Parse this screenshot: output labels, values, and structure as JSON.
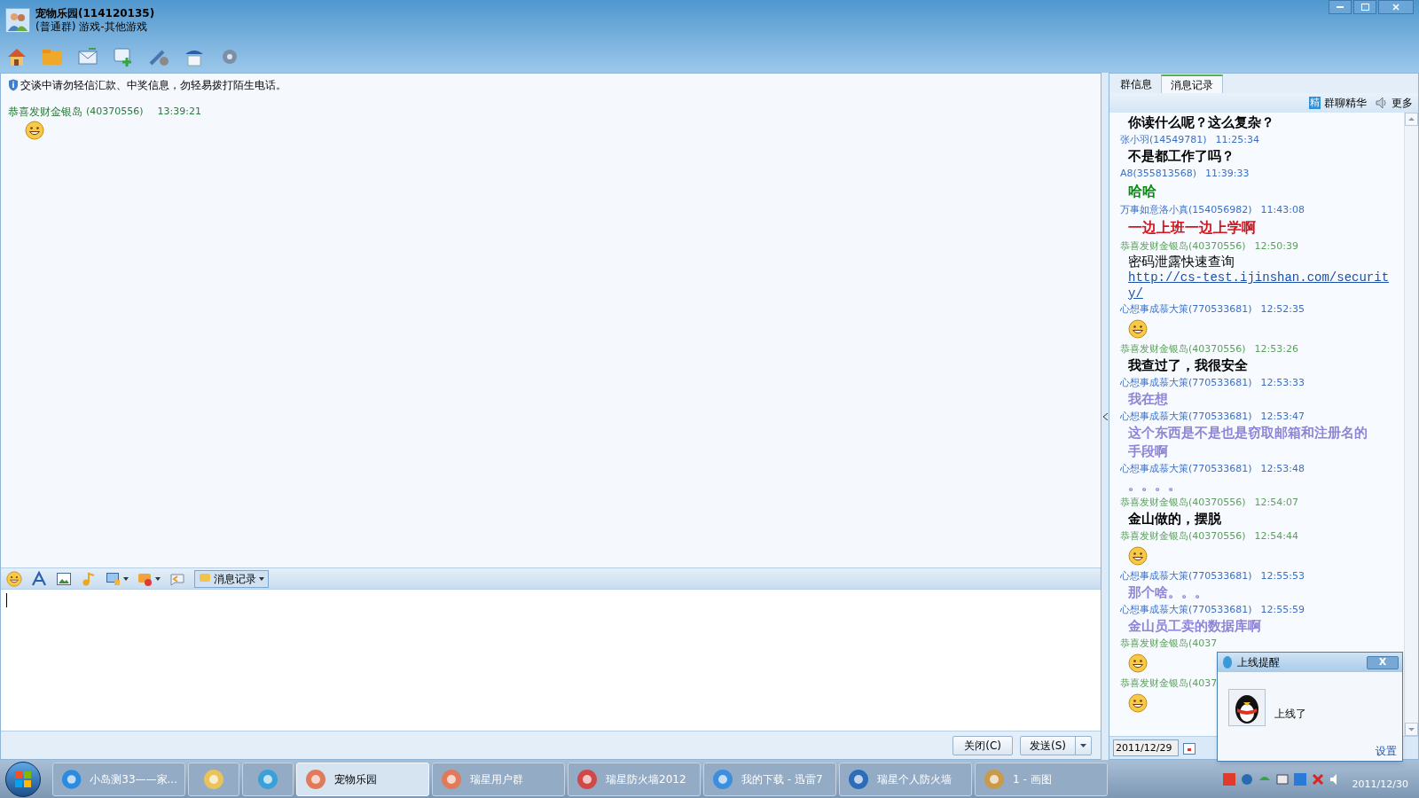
{
  "window": {
    "title": "宠物乐园(114120135)",
    "subtitle": "(普通群) 游戏-其他游戏"
  },
  "chat": {
    "notice": "交谈中请勿轻信汇款、中奖信息，勿轻易拨打陌生电话。",
    "messages": [
      {
        "sender": "恭喜发财金银岛",
        "id": "(40370556)",
        "time": "13:39:21"
      }
    ]
  },
  "input_toolbar": {
    "history_button": "消息记录"
  },
  "buttons": {
    "close": "关闭(C)",
    "send": "发送(S)"
  },
  "side_tabs": [
    {
      "label": "群信息",
      "selected": false
    },
    {
      "label": "消息记录",
      "selected": true
    }
  ],
  "side_toolbar": {
    "digest": "群聊精华",
    "digest_badge": "精",
    "more": "更多"
  },
  "history": [
    {
      "kind": "text",
      "text": "你读什么呢？这么复杂？",
      "color": "#000000"
    },
    {
      "kind": "header",
      "text": "张小羽(14549781)",
      "time": "11:25:34",
      "color": "#3b6fc6"
    },
    {
      "kind": "text",
      "text": "不是都工作了吗？",
      "color": "#000000"
    },
    {
      "kind": "header",
      "text": "A8(355813568)",
      "time": "11:39:33",
      "color": "#3b6fc6"
    },
    {
      "kind": "bold",
      "text": "哈哈",
      "color": "#0b8a12"
    },
    {
      "kind": "header",
      "text": "万事如意洛小真(154056982)",
      "time": "11:43:08",
      "color": "#3b6fc6"
    },
    {
      "kind": "bold",
      "text": "一边上班一边上学啊",
      "color": "#d4141c"
    },
    {
      "kind": "header",
      "text": "恭喜发财金银岛(40370556)",
      "time": "12:50:39",
      "color": "#5e9e5e"
    },
    {
      "kind": "link",
      "text": "密码泄露快速查询",
      "link": "http://cs-test.ijinshan.com/security/",
      "color": "#000000"
    },
    {
      "kind": "header",
      "text": "心想事成慕大策(770533681)",
      "time": "12:52:35",
      "color": "#3b6fc6"
    },
    {
      "kind": "emoji"
    },
    {
      "kind": "header",
      "text": "恭喜发财金银岛(40370556)",
      "time": "12:53:26",
      "color": "#5e9e5e"
    },
    {
      "kind": "text",
      "text": "我查过了，我很安全",
      "color": "#000000"
    },
    {
      "kind": "header",
      "text": "心想事成慕大策(770533681)",
      "time": "12:53:33",
      "color": "#3b6fc6"
    },
    {
      "kind": "text",
      "text": "我在想",
      "color": "#8f84d6"
    },
    {
      "kind": "header",
      "text": "心想事成慕大策(770533681)",
      "time": "12:53:47",
      "color": "#3b6fc6"
    },
    {
      "kind": "text",
      "text": "这个东西是不是也是窃取邮箱和注册名的手段啊",
      "color": "#8f84d6"
    },
    {
      "kind": "header",
      "text": "心想事成慕大策(770533681)",
      "time": "12:53:48",
      "color": "#3b6fc6"
    },
    {
      "kind": "text",
      "text": "。。。。",
      "color": "#8f84d6"
    },
    {
      "kind": "header",
      "text": "恭喜发财金银岛(40370556)",
      "time": "12:54:07",
      "color": "#5e9e5e"
    },
    {
      "kind": "text",
      "text": "金山做的，摆脱",
      "color": "#000000"
    },
    {
      "kind": "header",
      "text": "恭喜发财金银岛(40370556)",
      "time": "12:54:44",
      "color": "#5e9e5e"
    },
    {
      "kind": "emoji"
    },
    {
      "kind": "header",
      "text": "心想事成慕大策(770533681)",
      "time": "12:55:53",
      "color": "#3b6fc6"
    },
    {
      "kind": "text",
      "text": "那个啥。。。",
      "color": "#8f84d6"
    },
    {
      "kind": "header",
      "text": "心想事成慕大策(770533681)",
      "time": "12:55:59",
      "color": "#3b6fc6"
    },
    {
      "kind": "text",
      "text": "金山员工卖的数据库啊",
      "color": "#8f84d6"
    },
    {
      "kind": "header",
      "text": "恭喜发财金银岛(4037",
      "color": "#5e9e5e"
    },
    {
      "kind": "emoji"
    },
    {
      "kind": "header",
      "text": "恭喜发财金银岛(4037",
      "color": "#5e9e5e"
    },
    {
      "kind": "emoji"
    }
  ],
  "date_field": {
    "value": "2011/12/29"
  },
  "popup": {
    "title": "上线提醒",
    "close": "X",
    "message": "上线了",
    "settings": "设置"
  },
  "taskbar": {
    "items": [
      {
        "label": "小岛测33——家...",
        "selected": false
      },
      {
        "selected": false
      },
      {
        "selected": false
      },
      {
        "label": "宠物乐园",
        "selected": true
      },
      {
        "label": "瑞星用户群",
        "selected": false
      },
      {
        "label": "瑞星防火墙2012",
        "selected": false
      },
      {
        "label": "我的下载 - 迅雷7",
        "selected": false
      },
      {
        "label": "瑞星个人防火墙",
        "selected": false
      },
      {
        "label": "1 - 画图",
        "selected": false
      }
    ],
    "date": "2011/12/30"
  }
}
